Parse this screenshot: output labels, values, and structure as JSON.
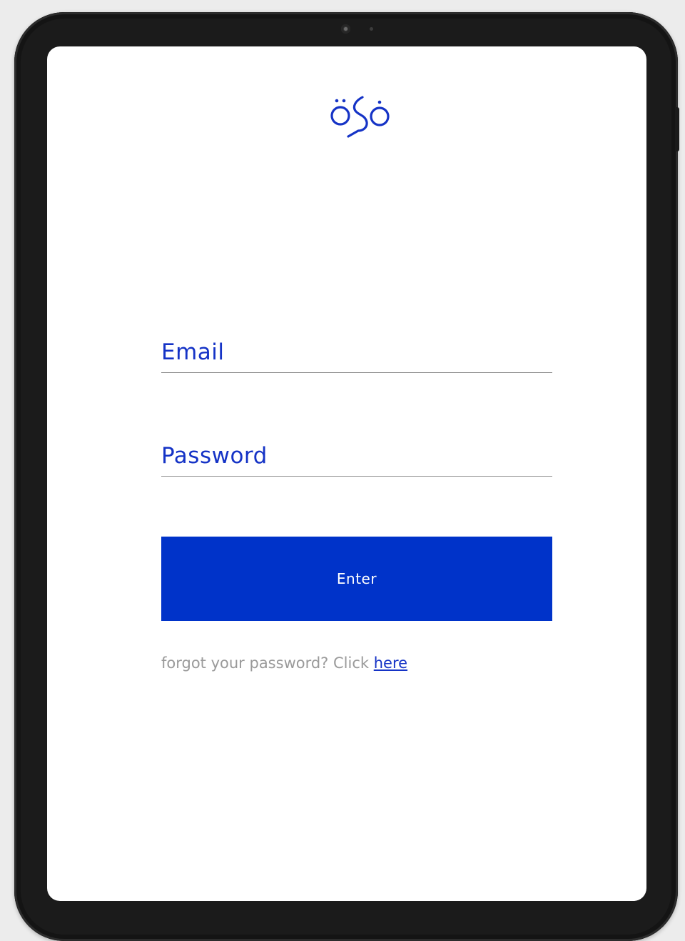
{
  "logo": {
    "icon": "brand-logo-icon",
    "color": "#1533c6"
  },
  "form": {
    "email_placeholder": "Email",
    "email_value": "",
    "password_placeholder": "Password",
    "password_value": "",
    "enter_label": "Enter"
  },
  "forgot": {
    "text": "forgot your password? Click ",
    "link_label": "here"
  },
  "colors": {
    "accent": "#0033c9",
    "label": "#1533c6",
    "muted": "#9a9a9a"
  }
}
